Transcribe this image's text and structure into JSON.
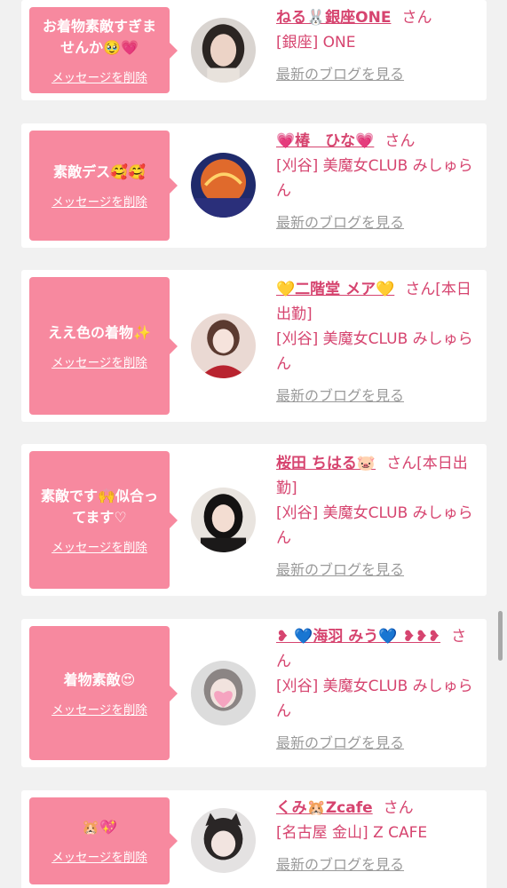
{
  "delete_label": "メッセージを削除",
  "blog_label": "最新のブログを見る",
  "cards": [
    {
      "message": "お着物素敵すぎませんか🥹💗",
      "name": "ねる🐰銀座ONE",
      "suffix": "さん",
      "shop": "[銀座] ONE",
      "avatar": "avatar-woman-dark-hair-icon"
    },
    {
      "message": "素敵デス🥰🥰",
      "name": "💗椿　ひな💗",
      "suffix": "さん",
      "shop": "[刈谷] 美魔女CLUB みしゅらん",
      "avatar": "avatar-neon-sign-icon"
    },
    {
      "message": "ええ色の着物✨",
      "name": "💛二階堂 メア💛",
      "suffix": "さん[本日出勤]",
      "shop": "[刈谷] 美魔女CLUB みしゅらん",
      "avatar": "avatar-woman-red-outfit-icon"
    },
    {
      "message": "素敵です🙌似合ってます♡",
      "name": "桜田 ちはる🐷",
      "suffix": "さん[本日出勤]",
      "shop": "[刈谷] 美魔女CLUB みしゅらん",
      "avatar": "avatar-woman-black-hair-icon"
    },
    {
      "message": "着物素敵😍",
      "name": "❥ 💙海羽 みう💙 ❥❥❥",
      "suffix": "さん",
      "shop": "[刈谷] 美魔女CLUB みしゅらん",
      "avatar": "avatar-woman-heart-sticker-icon"
    },
    {
      "message": "🐹💖",
      "name": "くみ🐹Zcafe",
      "suffix": "さん",
      "shop": "[名古屋 金山] Z CAFE",
      "avatar": "avatar-woman-cat-ears-icon"
    }
  ],
  "colors": {
    "accent_pink": "#f7899f",
    "name_pink": "#d6446f",
    "link_gray": "#9a9a9a",
    "background": "#f1f1f1"
  }
}
